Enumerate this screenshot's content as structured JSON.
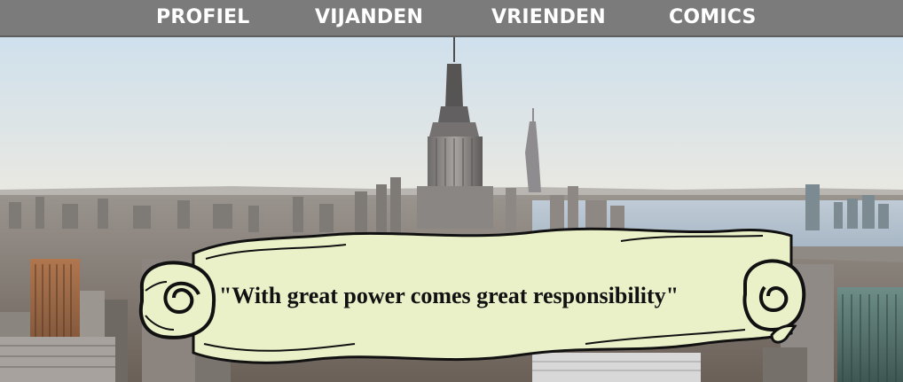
{
  "nav": {
    "items": [
      {
        "label": "PROFIEL"
      },
      {
        "label": "VIJANDEN"
      },
      {
        "label": "VRIENDEN"
      },
      {
        "label": "COMICS"
      }
    ]
  },
  "hero": {
    "quote": "\"With great power comes great responsibility\""
  },
  "colors": {
    "nav_background": "#7b7b7b",
    "nav_text": "#ffffff",
    "scroll_parchment": "#eaf0c8",
    "quote_text": "#111111"
  }
}
